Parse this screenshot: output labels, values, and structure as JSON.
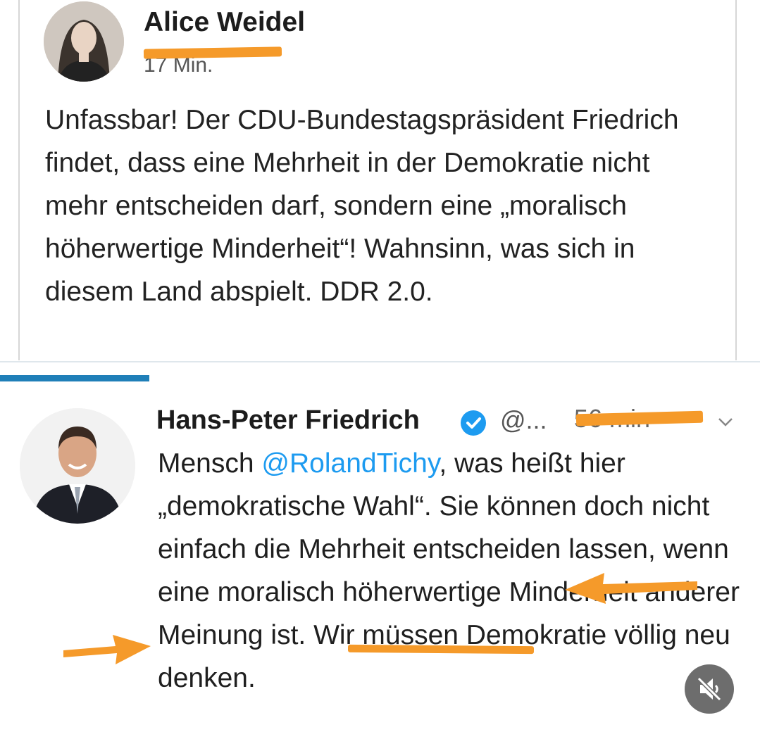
{
  "post1": {
    "author_name": "Alice Weidel",
    "time_label": "17 Min.",
    "text": "Unfassbar! Der CDU-Bundestagspräsident Friedrich findet, dass eine Mehrheit in der Demokratie nicht mehr entscheiden darf, sondern eine „moralisch höherwertige Minderheit“! Wahnsinn, was sich in diesem Land abspielt. DDR 2.0."
  },
  "post2": {
    "author_name": "Hans-Peter Friedrich",
    "handle": "@...",
    "time_label": "56 min",
    "text_part1": "Mensch ",
    "mention": "@RolandTichy",
    "text_part2": ", was heißt hier „demokratische Wahl“. Sie können doch nicht einfach die Mehrheit entscheiden lassen, wenn eine moralisch höherwertige ",
    "highlighted_word": "Minderheit",
    "text_part3": " anderer Meinung ist. Wir müssen Demokratie völlig neu denken."
  },
  "colors": {
    "annotation_orange": "#f59a2a",
    "mention_blue": "#1d9bf0",
    "progress_blue": "#1f7fb8",
    "text": "#1f1f1f"
  },
  "icons": {
    "verified": "verified-badge-icon",
    "chevron": "chevron-down-icon",
    "mute": "speaker-muted-icon"
  }
}
